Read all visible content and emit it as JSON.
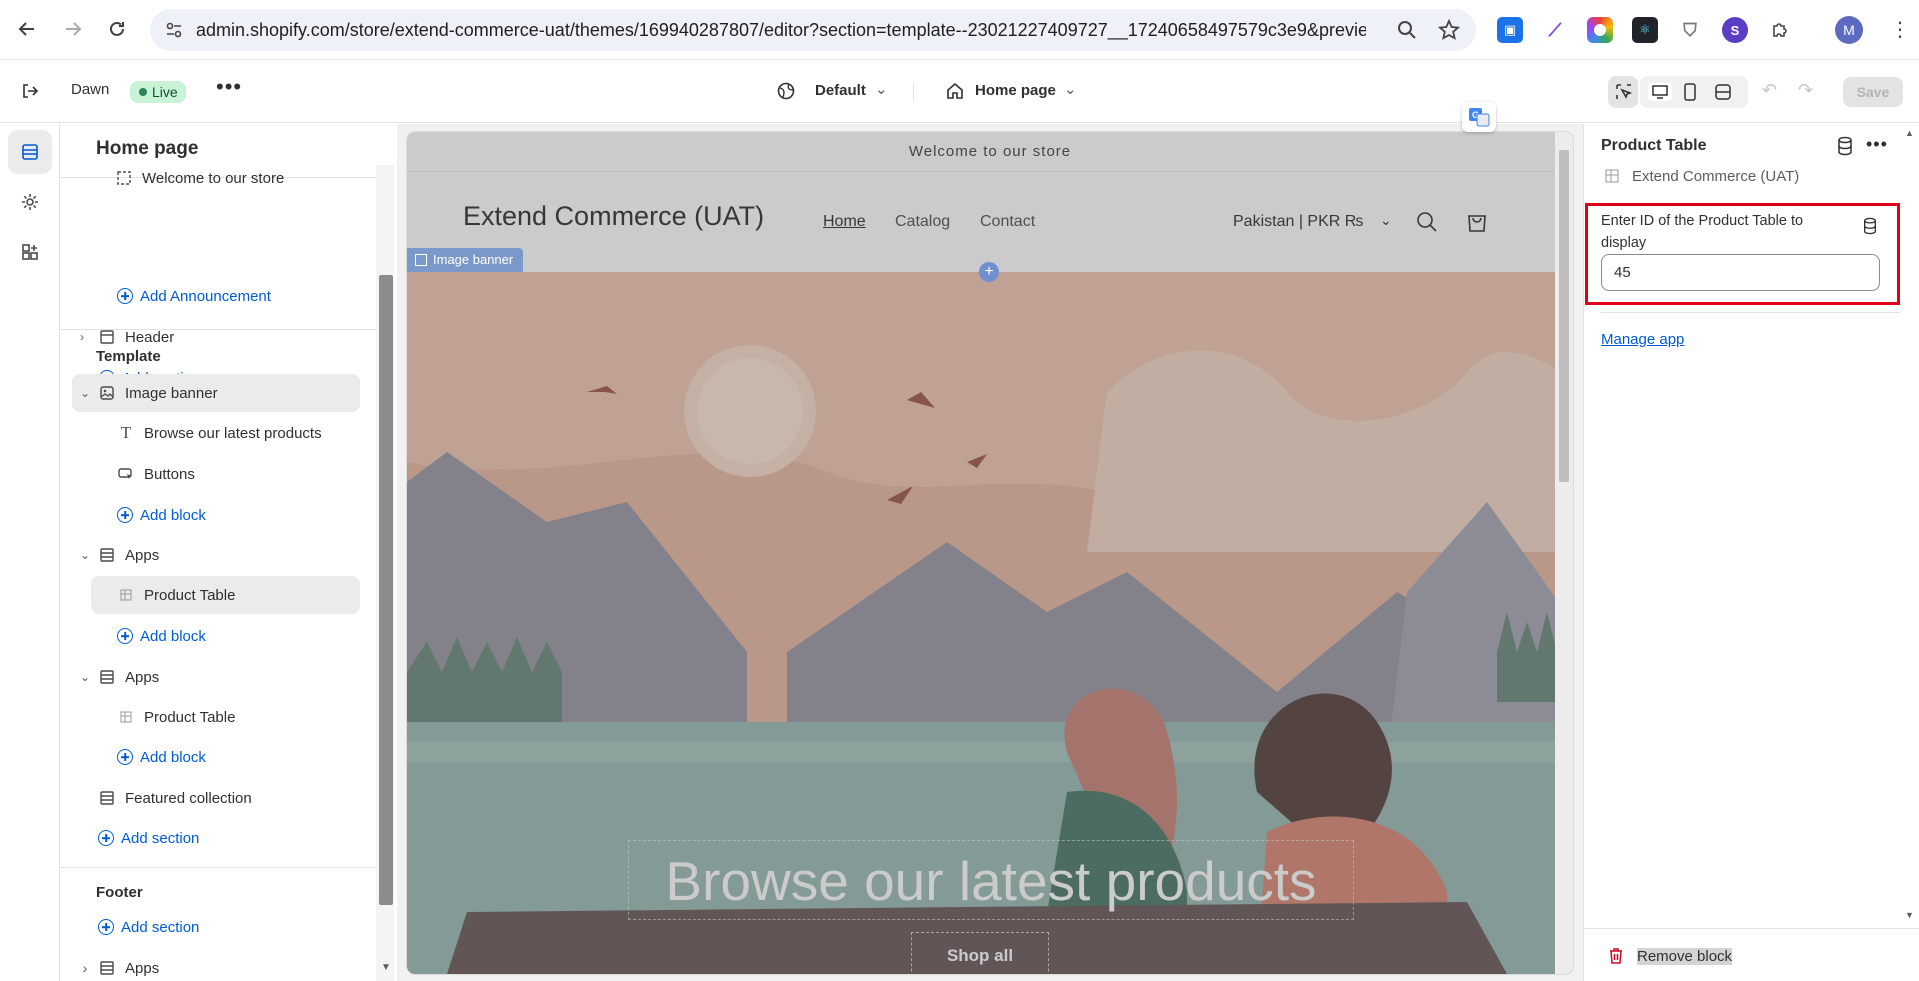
{
  "browser": {
    "url": "admin.shopify.com/store/extend-commerce-uat/themes/169940287807/editor?section=template--23021227409727__17240658497579c3e9&previewPa...",
    "profile_initial": "M",
    "ext_s_label": "S"
  },
  "topbar": {
    "theme_name": "Dawn",
    "live_badge": "Live",
    "default_label": "Default",
    "page_select": "Home page",
    "save_label": "Save"
  },
  "sidebar": {
    "title": "Home page",
    "items": {
      "welcome": "Welcome to our store",
      "add_announcement": "Add Announcement",
      "header": "Header",
      "add_section_1": "Add section",
      "template_heading": "Template",
      "image_banner": "Image banner",
      "browse_text": "Browse our latest products",
      "buttons": "Buttons",
      "add_block_1": "Add block",
      "apps_1": "Apps",
      "product_table_1": "Product Table",
      "add_block_2": "Add block",
      "apps_2": "Apps",
      "product_table_2": "Product Table",
      "add_block_3": "Add block",
      "featured_collection": "Featured collection",
      "add_section_2": "Add section",
      "footer_heading": "Footer",
      "add_section_3": "Add section",
      "apps_3": "Apps"
    }
  },
  "preview": {
    "announcement": "Welcome to our store",
    "store_name": "Extend Commerce (UAT)",
    "nav": [
      "Home",
      "Catalog",
      "Contact"
    ],
    "currency": "Pakistan | PKR ₨",
    "section_tag": "Image banner",
    "banner_heading": "Browse our latest products",
    "banner_button": "Shop all"
  },
  "panel": {
    "title": "Product Table",
    "app_name": "Extend Commerce (UAT)",
    "field_label": "Enter ID of the Product Table to display",
    "field_value": "45",
    "manage_link": "Manage app",
    "remove_label": "Remove block",
    "highlight_color": "#e0001b"
  },
  "colors": {
    "accent": "#005bd3",
    "live_bg": "#c9f2d6"
  }
}
